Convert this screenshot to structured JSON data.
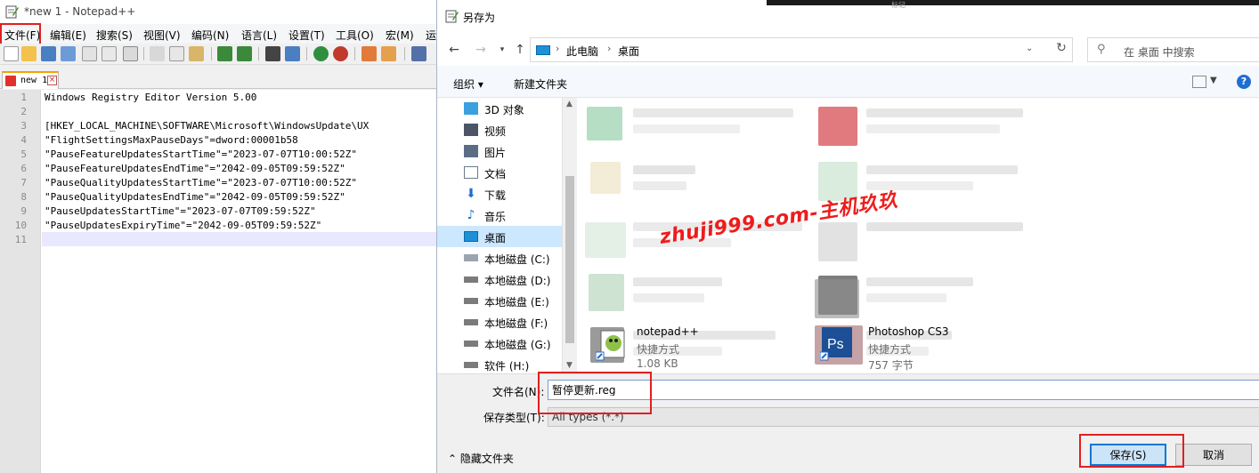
{
  "notepad": {
    "title": "*new 1 - Notepad++",
    "menu": [
      "文件(F)",
      "编辑(E)",
      "搜索(S)",
      "视图(V)",
      "编码(N)",
      "语言(L)",
      "设置(T)",
      "工具(O)",
      "宏(M)",
      "运"
    ],
    "tab_name": "new 1",
    "line_numbers": [
      "1",
      "2",
      "3",
      "4",
      "5",
      "6",
      "7",
      "8",
      "9",
      "10",
      "11"
    ],
    "lines": [
      "Windows Registry Editor Version 5.00",
      "",
      "[HKEY_LOCAL_MACHINE\\SOFTWARE\\Microsoft\\WindowsUpdate\\UX",
      "\"FlightSettingsMaxPauseDays\"=dword:00001b58",
      "\"PauseFeatureUpdatesStartTime\"=\"2023-07-07T10:00:52Z\"",
      "\"PauseFeatureUpdatesEndTime\"=\"2042-09-05T09:59:52Z\"",
      "\"PauseQualityUpdatesStartTime\"=\"2023-07-07T10:00:52Z\"",
      "\"PauseQualityUpdatesEndTime\"=\"2042-09-05T09:59:52Z\"",
      "\"PauseUpdatesStartTime\"=\"2023-07-07T09:59:52Z\"",
      "\"PauseUpdatesExpiryTime\"=\"2042-09-05T09:59:52Z\"",
      ""
    ]
  },
  "dialog": {
    "title": "另存为",
    "topstrip_text": "标记",
    "address": {
      "crumb1": "此电脑",
      "crumb2": "桌面"
    },
    "search_placeholder": "在 桌面 中搜索",
    "organize": "组织 ▾",
    "new_folder": "新建文件夹",
    "nav_items": [
      "3D 对象",
      "视频",
      "图片",
      "文档",
      "下载",
      "音乐",
      "桌面",
      "本地磁盘 (C:)",
      "本地磁盘 (D:)",
      "本地磁盘 (E:)",
      "本地磁盘 (F:)",
      "本地磁盘 (G:)",
      "软件 (H:)"
    ],
    "watermark": "zhuji999.com-主机玖玖",
    "files": [
      {
        "name": "notepad++",
        "type": "快捷方式",
        "size": "1.08 KB"
      },
      {
        "name": "Photoshop CS3",
        "type": "快捷方式",
        "size": "757 字节"
      }
    ],
    "filename_label": "文件名(N):",
    "filename_value": "暂停更新.reg",
    "filetype_label": "保存类型(T):",
    "filetype_value": "All types (*.*)",
    "hide_folders": "隐藏文件夹",
    "save_label": "保存(S)",
    "cancel_label": "取消"
  },
  "colors": {
    "accent": "#0078d7",
    "highlight_red": "#e02020",
    "selection": "#cce8ff"
  }
}
